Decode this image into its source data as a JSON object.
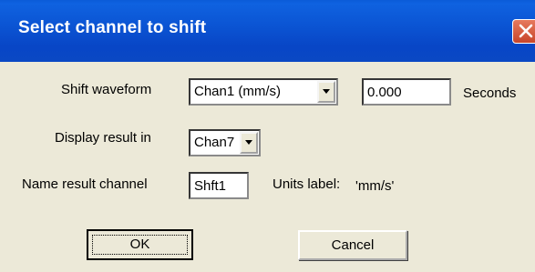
{
  "dialog": {
    "title": "Select channel to shift",
    "close_icon": "close-icon"
  },
  "shift_waveform": {
    "label": "Shift waveform",
    "channel_selected": "Chan1 (mm/s)",
    "offset_value": "0.000",
    "units": "Seconds"
  },
  "display_result": {
    "label": "Display result in",
    "channel_selected": "Chan7"
  },
  "name_result": {
    "label": "Name result channel",
    "value": "Shft1",
    "units_label": "Units label:",
    "units_value": "'mm/s'"
  },
  "buttons": {
    "ok": "OK",
    "cancel": "Cancel"
  },
  "colors": {
    "titlebar": "#0a52d0",
    "close": "#d9593c",
    "face": "#ece9d8"
  }
}
